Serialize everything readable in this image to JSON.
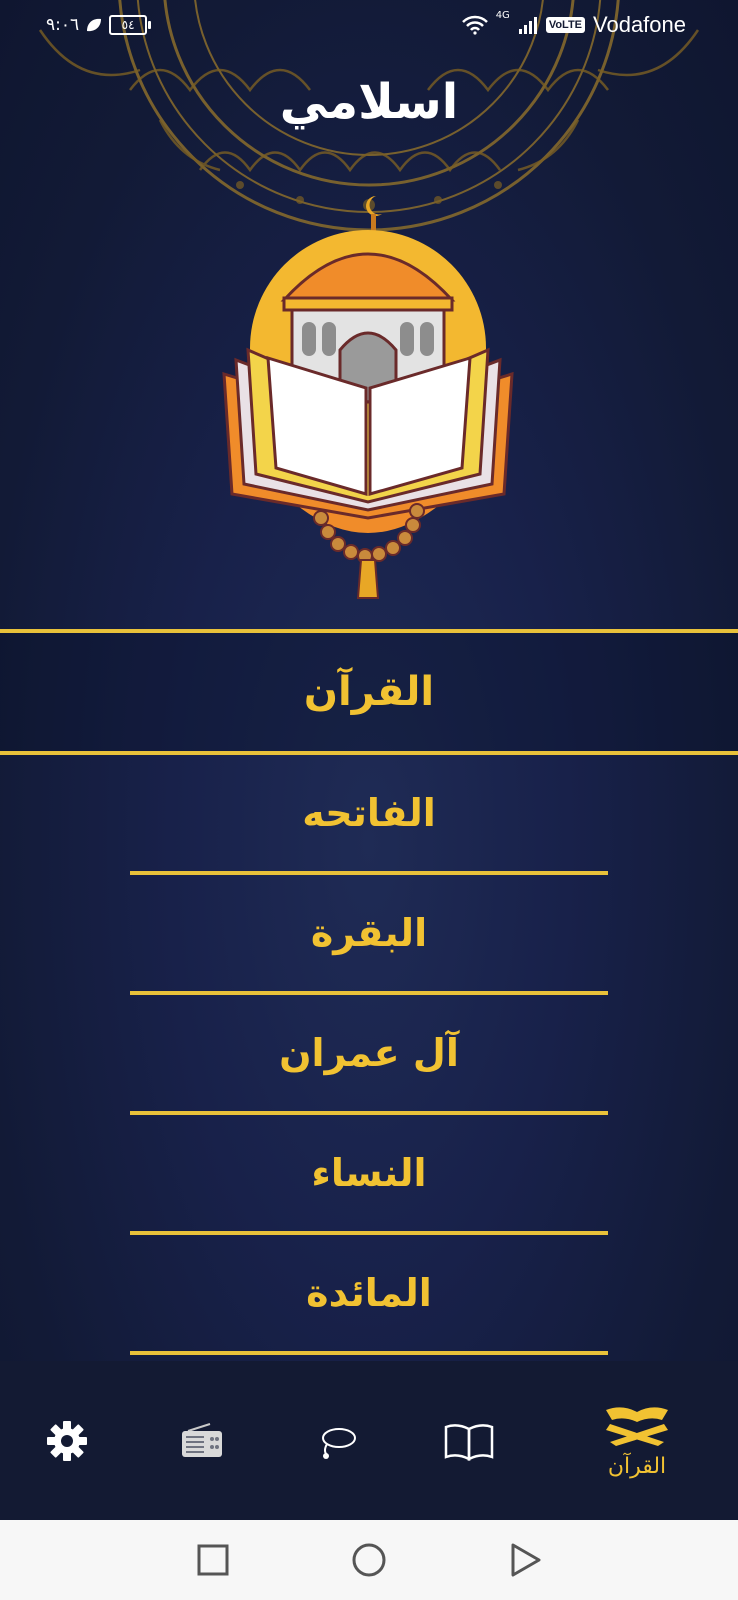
{
  "status_bar": {
    "time": "٩:٠٦",
    "battery": "٥٤",
    "network": "4G",
    "volte": "VoLTE",
    "carrier": "Vodafone"
  },
  "app_title": "اسلامي",
  "quran_header": "القرآن",
  "suras": [
    "الفاتحه",
    "البقرة",
    "آل عمران",
    "النساء",
    "المائدة"
  ],
  "bottom_nav": {
    "items": [
      {
        "icon": "settings-icon"
      },
      {
        "icon": "radio-icon"
      },
      {
        "icon": "tasbeeh-icon"
      },
      {
        "icon": "book-icon"
      },
      {
        "icon": "quran-icon",
        "label": "القرآن",
        "active": true
      }
    ]
  },
  "colors": {
    "accent": "#f1c232",
    "background": "#18214a",
    "nav_background": "#131a33"
  }
}
